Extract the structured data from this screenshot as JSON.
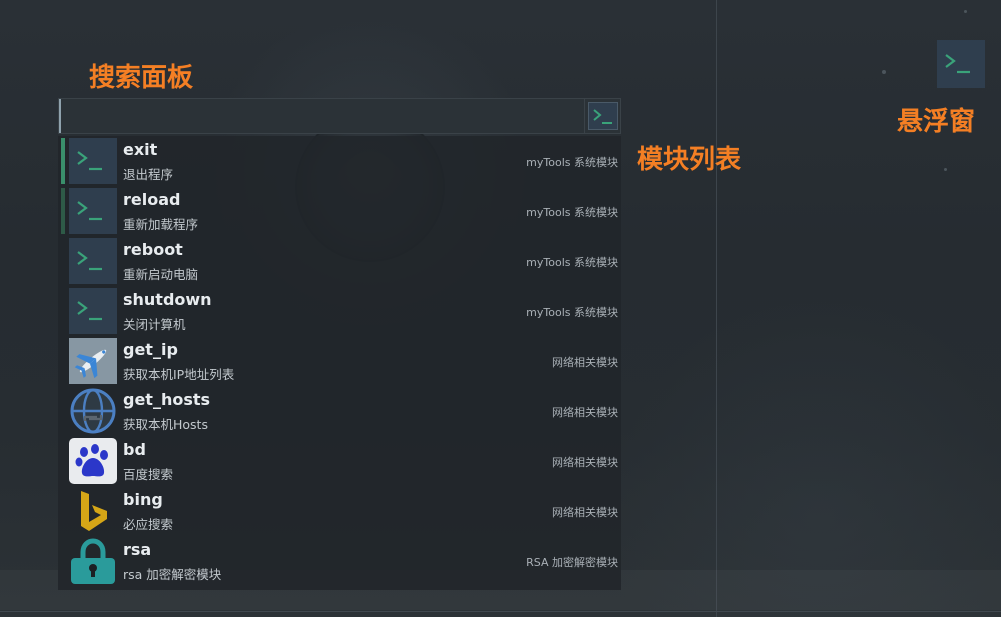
{
  "annotations": {
    "search_panel": "搜索面板",
    "module_list": "模块列表",
    "float_window": "悬浮窗"
  },
  "search": {
    "value": "",
    "placeholder": ""
  },
  "items": [
    {
      "name": "exit",
      "desc": "退出程序",
      "category": "myTools 系统模块",
      "icon": "terminal-icon",
      "accent": "#3a8f6b"
    },
    {
      "name": "reload",
      "desc": "重新加载程序",
      "category": "myTools 系统模块",
      "icon": "terminal-icon",
      "accent": "#2e5a47"
    },
    {
      "name": "reboot",
      "desc": "重新启动电脑",
      "category": "myTools 系统模块",
      "icon": "terminal-icon",
      "accent": ""
    },
    {
      "name": "shutdown",
      "desc": "关闭计算机",
      "category": "myTools 系统模块",
      "icon": "terminal-icon",
      "accent": ""
    },
    {
      "name": "get_ip",
      "desc": "获取本机IP地址列表",
      "category": "网络相关模块",
      "icon": "airplane-icon",
      "accent": ""
    },
    {
      "name": "get_hosts",
      "desc": "获取本机Hosts",
      "category": "网络相关模块",
      "icon": "globe-sync-icon",
      "accent": ""
    },
    {
      "name": "bd",
      "desc": "百度搜索",
      "category": "网络相关模块",
      "icon": "baidu-paw-icon",
      "accent": ""
    },
    {
      "name": "bing",
      "desc": "必应搜索",
      "category": "网络相关模块",
      "icon": "bing-logo-icon",
      "accent": ""
    },
    {
      "name": "rsa",
      "desc": "rsa 加密解密模块",
      "category": "RSA 加密解密模块",
      "icon": "padlock-icon",
      "accent": ""
    }
  ],
  "colors": {
    "annotation": "#f47f24",
    "terminal_tile": "#2f3e4e",
    "terminal_glyph": "#3aa37a",
    "active_accent": "#3a8f6b"
  }
}
